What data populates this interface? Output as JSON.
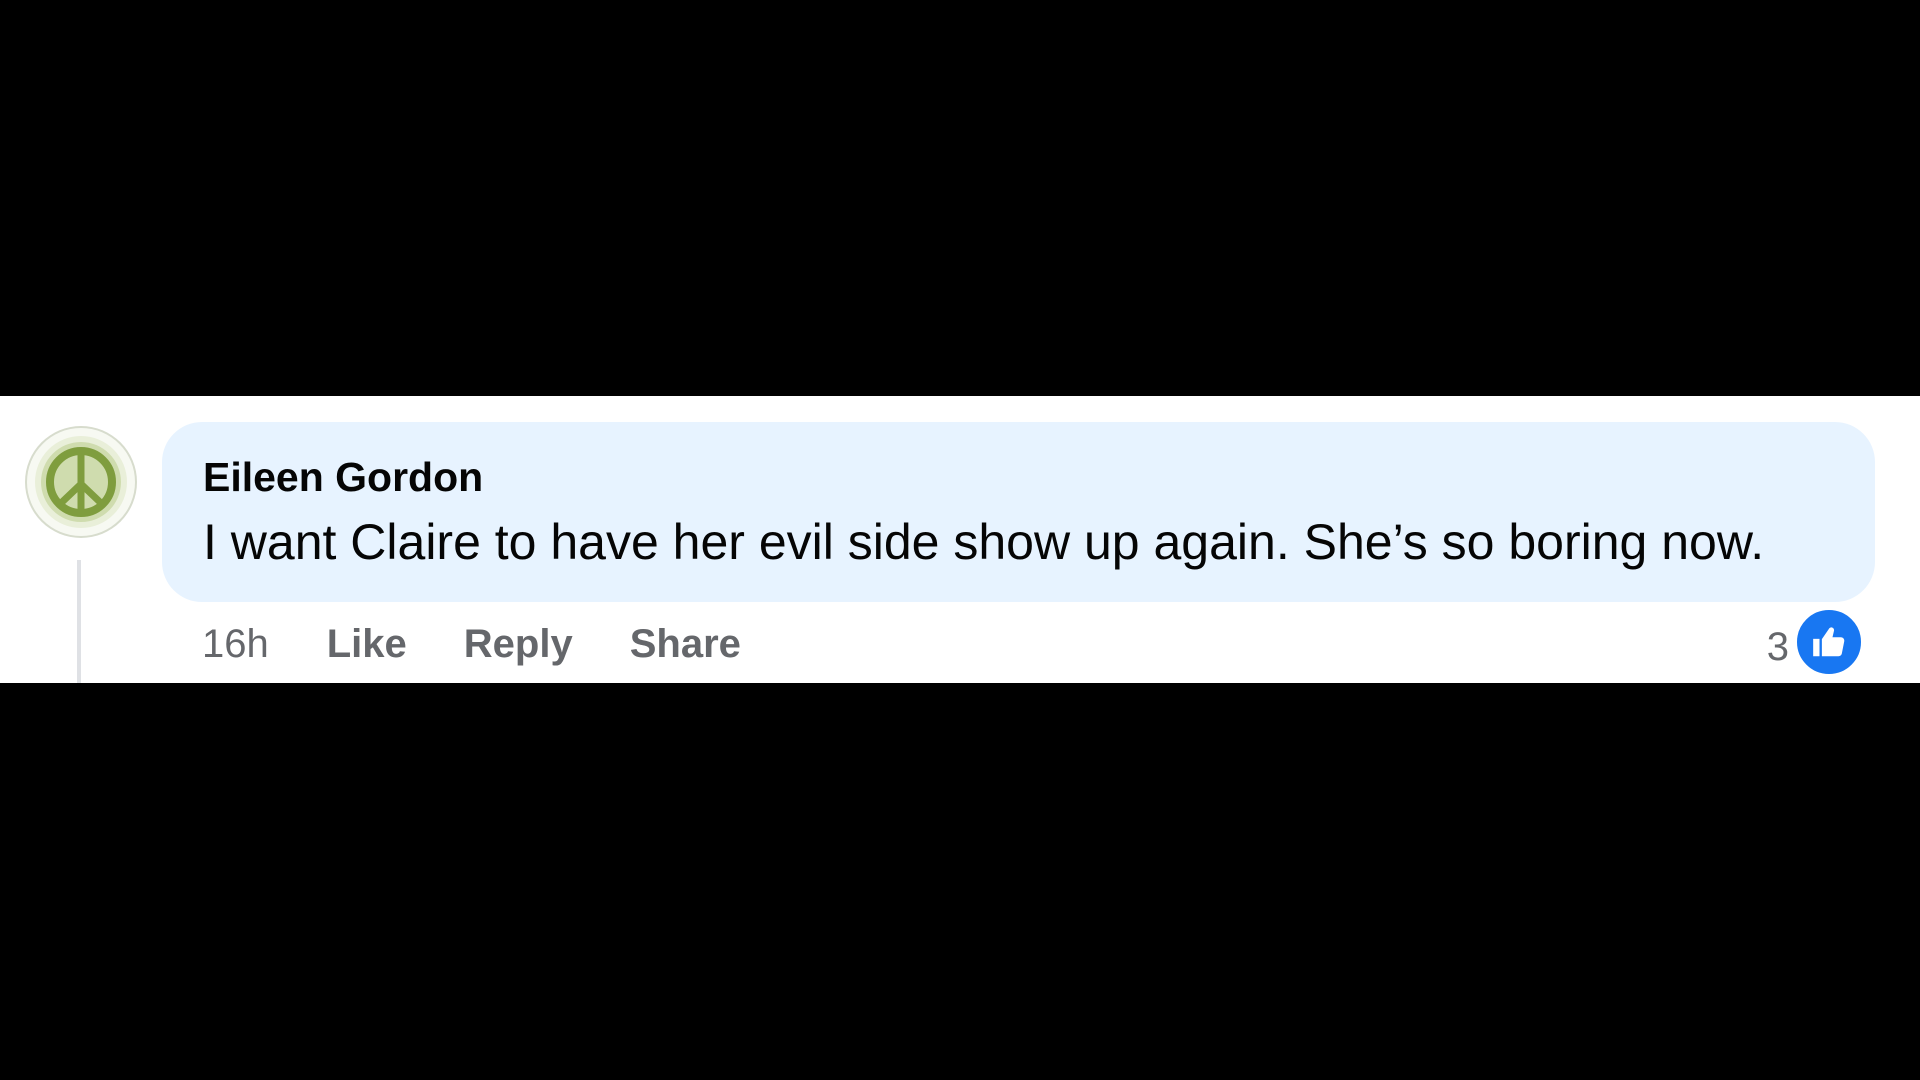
{
  "comment": {
    "author": "Eileen Gordon",
    "text": "I want Claire to have her evil side show up again. She’s so boring now.",
    "avatar_icon": "peace-sign-icon",
    "colors": {
      "bubble": "#e7f3ff",
      "text": "#050505",
      "meta": "#65676b",
      "like_badge": "#1877f2",
      "avatar_symbol": "#8aa84a"
    }
  },
  "actions": {
    "time": "16h",
    "like_label": "Like",
    "reply_label": "Reply",
    "share_label": "Share"
  },
  "reactions": {
    "count": "3",
    "icon": "thumbs-up-icon"
  }
}
